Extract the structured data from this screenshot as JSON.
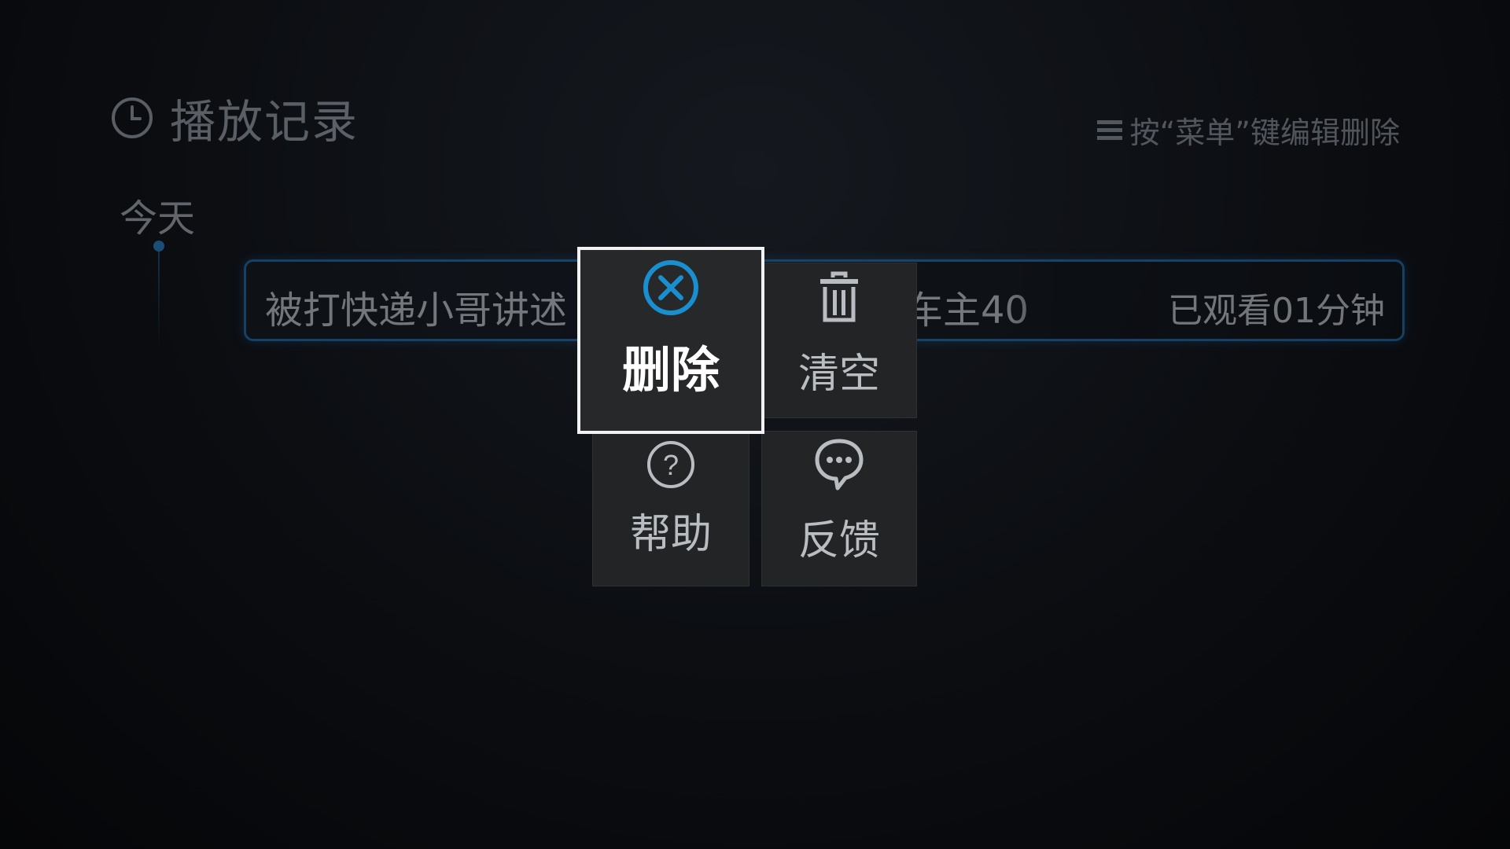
{
  "header": {
    "title": "播放记录",
    "icon": "clock-icon",
    "menu_hint": "按“菜单”键编辑删除",
    "menu_icon": "menu-icon"
  },
  "history": {
    "section_label": "今天",
    "items": [
      {
        "title": "被打快递小哥讲述",
        "title_tail": "车主40",
        "progress": "已观看01分钟"
      }
    ]
  },
  "popup_menu": {
    "selected": "delete",
    "items": [
      {
        "id": "delete",
        "label": "删除",
        "icon": "close-circle-icon"
      },
      {
        "id": "clear",
        "label": "清空",
        "icon": "trash-icon"
      },
      {
        "id": "help",
        "label": "帮助",
        "icon": "help-circle-icon"
      },
      {
        "id": "feedback",
        "label": "反馈",
        "icon": "chat-bubble-icon"
      }
    ]
  },
  "colors": {
    "accent": "#1a8fd0",
    "focus_border": "#f2f2f2",
    "tile_bg": "#222426",
    "row_border": "#1f6aa8"
  }
}
